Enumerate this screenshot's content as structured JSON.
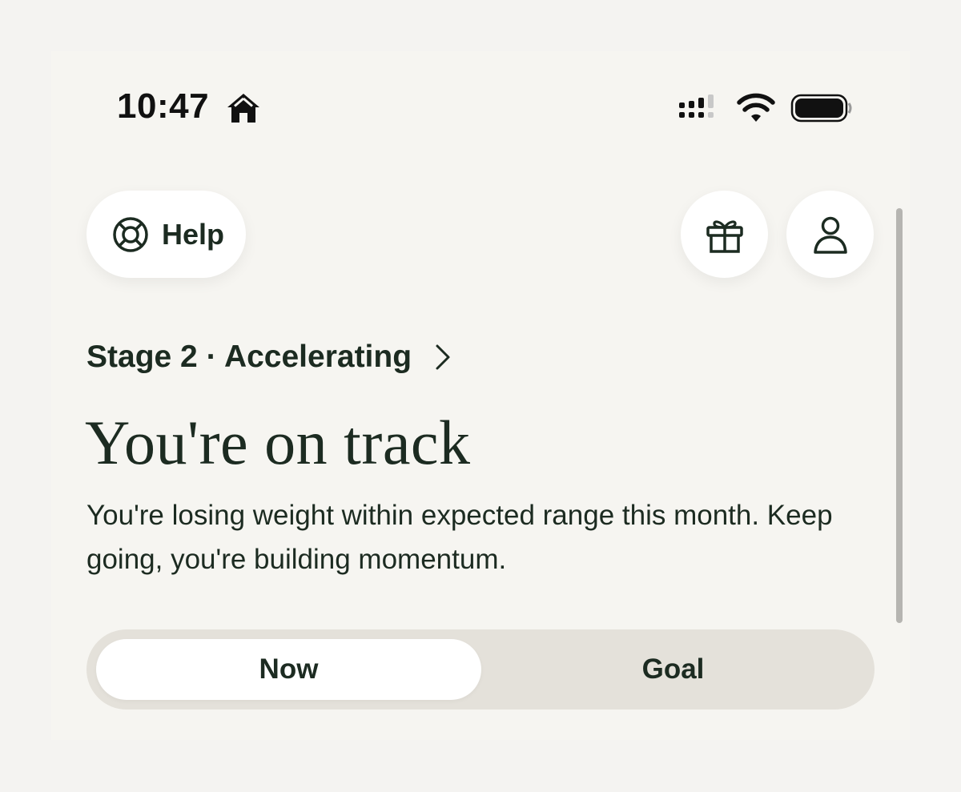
{
  "status_bar": {
    "time": "10:47"
  },
  "header": {
    "help_label": "Help"
  },
  "stage": {
    "label": "Stage 2 · Accelerating"
  },
  "headline": "You're on track",
  "description": "You're losing weight within expected range this month. Keep going, you're building momentum.",
  "segmented_control": {
    "selected": "Now",
    "options": [
      "Now",
      "Goal"
    ]
  },
  "icons": {
    "status": [
      "home-icon",
      "signal-icon",
      "wifi-icon",
      "battery-icon"
    ],
    "help": "lifebuoy-icon",
    "gift": "gift-icon",
    "profile": "person-icon",
    "stage": "chevron-right-icon"
  },
  "colors": {
    "background": "#f6f5f1",
    "text": "#1c2b21",
    "segment_track": "#e4e1da",
    "card": "#ffffff"
  }
}
